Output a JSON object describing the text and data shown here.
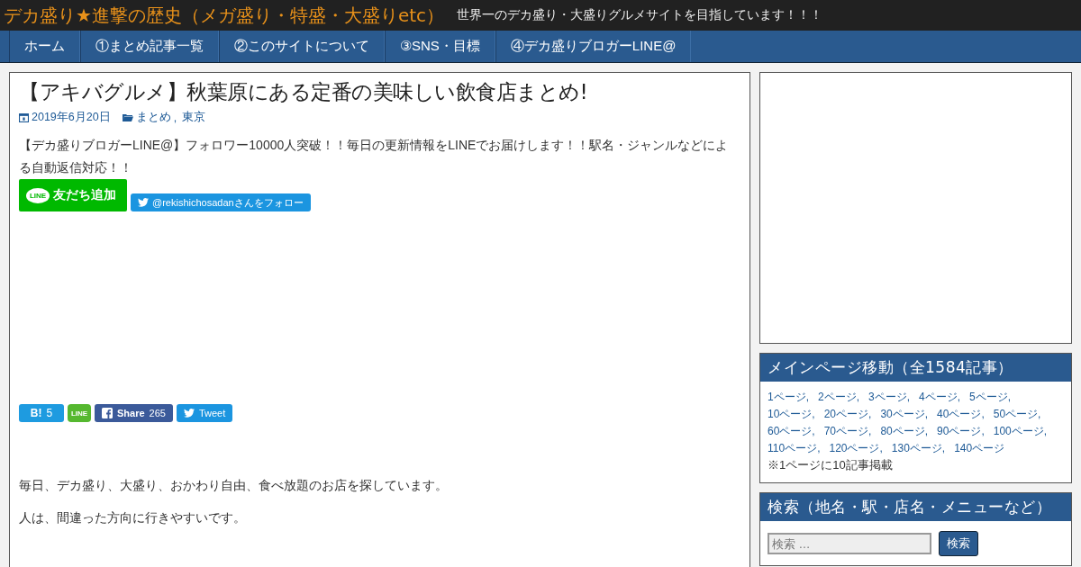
{
  "header": {
    "site_title": "デカ盛り★進撃の歴史（メガ盛り・特盛・大盛りetc）",
    "tagline": "世界一のデカ盛り・大盛りグルメサイトを目指しています！！！"
  },
  "nav": [
    {
      "label": "ホーム"
    },
    {
      "label": "①まとめ記事一覧"
    },
    {
      "label": "②このサイトについて"
    },
    {
      "label": "③SNS・目標"
    },
    {
      "label": "④デカ盛りブロガーLINE@"
    }
  ],
  "article": {
    "title": "【アキバグルメ】秋葉原にある定番の美味しい飲食店まとめ!",
    "date": "2019年6月20日",
    "categories": [
      {
        "label": "まとめ",
        "sep": ","
      },
      {
        "label": "東京"
      }
    ],
    "notice": "【デカ盛りブロガーLINE@】フォロワー10000人突破！！毎日の更新情報をLINEでお届けします！！駅名・ジャンルなどによる自動返信対応！！",
    "line_button": {
      "badge": "LINE",
      "label": "友だち追加"
    },
    "follow_button": "@rekishichosadanさんをフォロー",
    "share": {
      "hatena": {
        "label": "B!",
        "count": "5"
      },
      "line_badge": "LINE",
      "facebook": {
        "label": "Share",
        "count": "265"
      },
      "twitter": {
        "label": "Tweet"
      }
    },
    "paragraphs": [
      "毎日、デカ盛り、大盛り、おかわり自由、食べ放題のお店を探しています。",
      "人は、間違った方向に行きやすいです。"
    ]
  },
  "sidebar": {
    "pages_widget": {
      "title": "メインページ移動（全1584記事）",
      "links": [
        "1ページ,",
        "2ページ,",
        "3ページ,",
        "4ページ,",
        "5ページ,",
        "10ページ,",
        "20ページ,",
        "30ページ,",
        "40ページ,",
        "50ページ,",
        "60ページ,",
        "70ページ,",
        "80ページ,",
        "90ページ,",
        "100ページ,",
        "110ページ,",
        "120ページ,",
        "130ページ,",
        "140ページ"
      ],
      "note": "※1ページに10記事掲載"
    },
    "search_widget": {
      "title": "検索（地名・駅・店名・メニューなど）",
      "placeholder": "検索 …",
      "button": "検索"
    }
  }
}
